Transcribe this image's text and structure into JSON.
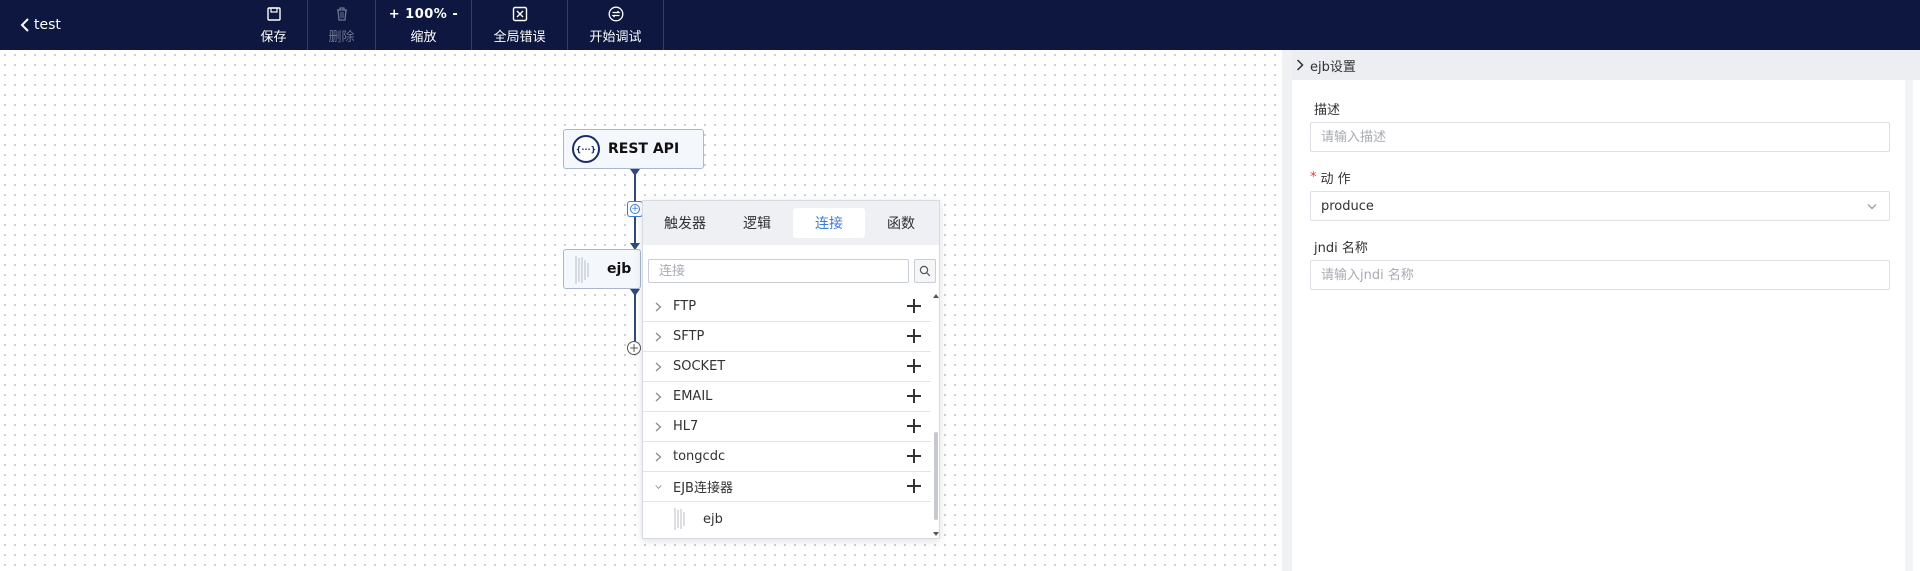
{
  "topbar": {
    "back_label": "test",
    "save_label": "保存",
    "delete_label": "删除",
    "zoom_value": "+ 100% -",
    "zoom_label": "缩放",
    "global_error_label": "全局错误",
    "debug_label": "开始调试"
  },
  "canvas": {
    "nodes": [
      {
        "label": "REST API",
        "icon": "rest-api-icon"
      },
      {
        "label": "ejb",
        "icon": "ejb-icon"
      }
    ]
  },
  "popover": {
    "tabs": [
      "触发器",
      "逻辑",
      "连接",
      "函数"
    ],
    "active_tab": "连接",
    "search_placeholder": "连接",
    "items": [
      "FTP",
      "SFTP",
      "SOCKET",
      "EMAIL",
      "HL7",
      "tongcdc",
      "EJB连接器"
    ],
    "expanded_item": "EJB连接器",
    "sub_items": [
      "ejb"
    ]
  },
  "panel": {
    "title": "ejb设置",
    "desc_label": "描述",
    "desc_placeholder": "请输入描述",
    "action_required_mark": "*",
    "action_label": "动 作",
    "action_value": "produce",
    "jndi_label": "jndi 名称",
    "jndi_placeholder": "请输入jndi 名称"
  },
  "colors": {
    "topbar_bg": "#0d1740",
    "accent": "#3d7bd9",
    "required": "#e03c3c"
  }
}
